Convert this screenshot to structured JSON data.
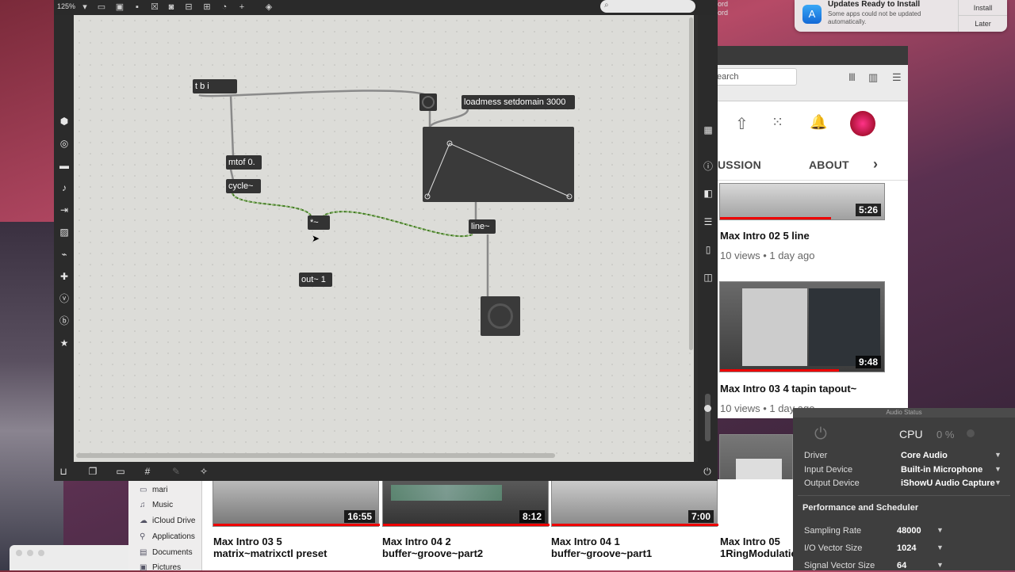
{
  "notification": {
    "title": "Updates Ready to Install",
    "body": "Some apps could not be updated automatically.",
    "install": "Install",
    "later": "Later"
  },
  "desktop_fragments": [
    "ord",
    "ord"
  ],
  "max": {
    "zoom": "125%",
    "objects": {
      "tbi": "t b i",
      "loadmess": "loadmess setdomain 3000",
      "mtof": "mtof 0.",
      "cycle": "cycle~",
      "times": "*~",
      "line": "line~",
      "out": "out~ 1"
    }
  },
  "browser": {
    "search_placeholder": "earch",
    "tabs": [
      "USSION",
      "ABOUT"
    ],
    "videos_right": [
      {
        "title": "Max Intro 02 5 line",
        "meta": "10 views • 1 day ago",
        "duration": "5:26"
      },
      {
        "title": "Max Intro 03 4 tapin tapout~",
        "meta": "10 views • 1 day ago",
        "duration": "9:48"
      }
    ],
    "videos_bottom": [
      {
        "line1": "Max Intro 03 5",
        "line2": "matrix~matrixctl preset",
        "duration": "16:55"
      },
      {
        "line1": "Max Intro 04 2",
        "line2": "buffer~groove~part2",
        "duration": "8:12"
      },
      {
        "line1": "Max Intro 04 1",
        "line2": "buffer~groove~part1",
        "duration": "7:00"
      },
      {
        "line1": "Max Intro 05",
        "line2": "1RingModulatio",
        "duration": ""
      }
    ]
  },
  "finder": {
    "items": [
      "mari",
      "Music",
      "iCloud Drive",
      "Applications",
      "Documents",
      "Pictures"
    ]
  },
  "audio": {
    "header": "Audio Status",
    "cpu_label": "CPU",
    "cpu_value": "0 %",
    "driver_label": "Driver",
    "driver_value": "Core Audio",
    "input_label": "Input Device",
    "input_value": "Built-in Microphone",
    "output_label": "Output Device",
    "output_value": "iShowU Audio Capture",
    "section": "Performance and Scheduler",
    "sr_label": "Sampling Rate",
    "sr_value": "48000",
    "io_label": "I/O Vector Size",
    "io_value": "1024",
    "sv_label": "Signal Vector Size",
    "sv_value": "64"
  }
}
